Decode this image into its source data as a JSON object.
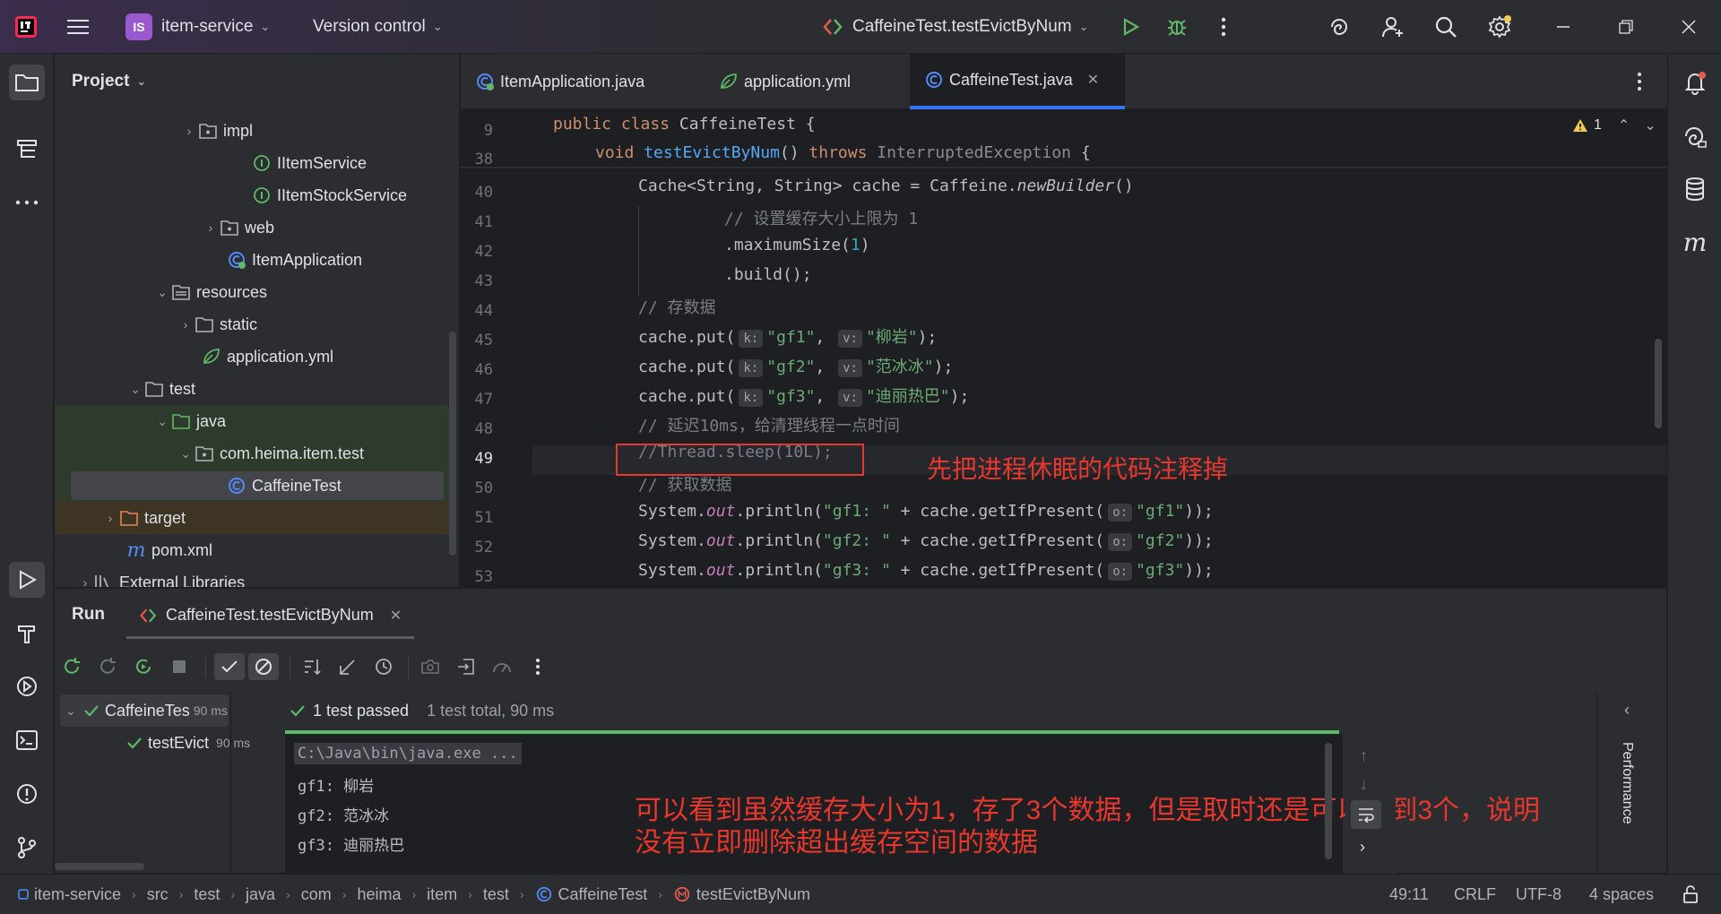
{
  "titlebar": {
    "project_badge": "IS",
    "project_name": "item-service",
    "vcs_label": "Version control",
    "run_config": "CaffeineTest.testEvictByNum"
  },
  "project_panel": {
    "title": "Project",
    "tree": [
      {
        "label": "impl",
        "icon": "package-icon"
      },
      {
        "label": "IItemService",
        "icon": "interface-icon"
      },
      {
        "label": "IItemStockService",
        "icon": "interface-icon"
      },
      {
        "label": "web",
        "icon": "package-icon"
      },
      {
        "label": "ItemApplication",
        "icon": "spring-class-icon"
      },
      {
        "label": "resources",
        "icon": "folder-icon"
      },
      {
        "label": "static",
        "icon": "folder-icon"
      },
      {
        "label": "application.yml",
        "icon": "yaml-icon"
      },
      {
        "label": "test",
        "icon": "folder-icon"
      },
      {
        "label": "java",
        "icon": "folder-icon"
      },
      {
        "label": "com.heima.item.test",
        "icon": "package-icon"
      },
      {
        "label": "CaffeineTest",
        "icon": "class-icon"
      },
      {
        "label": "target",
        "icon": "folder-icon"
      },
      {
        "label": "pom.xml",
        "icon": "maven-icon"
      },
      {
        "label": "External Libraries",
        "icon": "library-icon"
      }
    ]
  },
  "editor": {
    "tabs": [
      {
        "label": "ItemApplication.java"
      },
      {
        "label": "application.yml"
      },
      {
        "label": "CaffeineTest.java"
      }
    ],
    "warning_count": "1",
    "line_numbers": [
      "9",
      "38",
      "40",
      "41",
      "42",
      "43",
      "44",
      "45",
      "46",
      "47",
      "48",
      "49",
      "50",
      "51",
      "52",
      "53"
    ],
    "annotation_box_text": "先把进程休眠的代码注释掉"
  },
  "run_panel": {
    "title": "Run",
    "config_tab": "CaffeineTest.testEvictByNum",
    "tree_root": "CaffeineTes",
    "tree_root_time": "90 ms",
    "tree_child": "testEvict",
    "tree_child_time": "90 ms",
    "status_passed": "1 test passed",
    "status_total": "1 test total, 90 ms",
    "console_lines": [
      "C:\\Java\\bin\\java.exe ...",
      "gf1: 柳岩",
      "gf2: 范冰冰",
      "gf3: 迪丽热巴"
    ],
    "annotation_line1": "可以看到虽然缓存大小为1，存了3个数据，但是取时还是可以取到3个，说明",
    "annotation_line2": "没有立即删除超出缓存空间的数据",
    "side_label": "Performance"
  },
  "statusbar": {
    "breadcrumbs": [
      "item-service",
      "src",
      "test",
      "java",
      "com",
      "heima",
      "item",
      "test",
      "CaffeineTest",
      "testEvictByNum"
    ],
    "position": "49:11",
    "line_ending": "CRLF",
    "encoding": "UTF-8",
    "indent": "4 spaces"
  },
  "colors": {
    "accent": "#3574f0",
    "annotation": "#e8372c",
    "success": "#5fb865"
  }
}
